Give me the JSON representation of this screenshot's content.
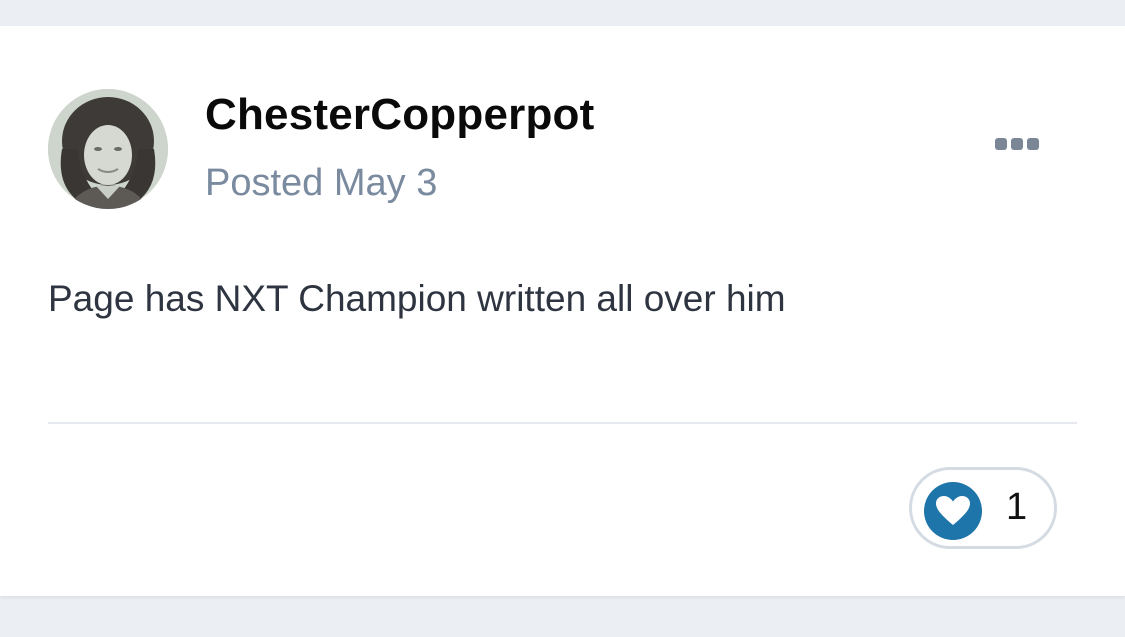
{
  "post": {
    "author": "ChesterCopperpot",
    "date_text": "Posted May 3",
    "body": "Page has NXT Champion written all over him"
  },
  "reactions": {
    "icon": "heart-icon",
    "count": "1",
    "accent_color": "#1e75aa"
  },
  "menu": {
    "icon": "more-options-icon"
  },
  "colors": {
    "background": "#ebeef3",
    "card": "#ffffff",
    "muted_text": "#7a8a9f"
  }
}
